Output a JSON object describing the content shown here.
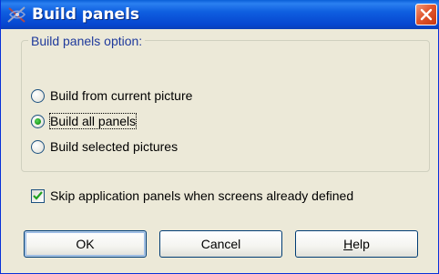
{
  "window": {
    "title": "Build panels"
  },
  "group": {
    "title": "Build panels option:",
    "options": [
      {
        "label": "Build from current picture",
        "selected": false
      },
      {
        "label": "Build all panels",
        "selected": true
      },
      {
        "label": "Build selected pictures",
        "selected": false
      }
    ]
  },
  "skip_checkbox": {
    "label": "Skip application panels when screens already defined",
    "checked": true
  },
  "buttons": {
    "ok": "OK",
    "cancel": "Cancel",
    "help_mnemonic": "H",
    "help_rest": "elp"
  },
  "colors": {
    "title_bar": "#0a53d6",
    "group_title": "#1f3a9c",
    "close_button": "#e1562f",
    "radio_selected": "#21a121"
  }
}
